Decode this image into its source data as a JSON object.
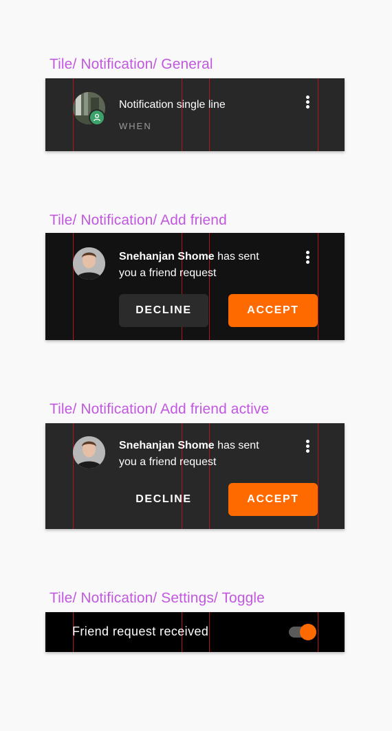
{
  "sections": {
    "general": {
      "title": "Tile/ Notification/ General",
      "line": "Notification single line",
      "when": "WHEN"
    },
    "add_friend": {
      "title": "Tile/ Notification/ Add friend",
      "name": "Snehanjan Shome",
      "message_part1": "has sent",
      "message_part2": "you a friend request",
      "decline": "DECLINE",
      "accept": "ACCEPT"
    },
    "add_friend_active": {
      "title": "Tile/ Notification/ Add friend active",
      "name": "Snehanjan Shome",
      "message_part1": "has sent",
      "message_part2": "you a friend request",
      "decline": "DECLINE",
      "accept": "ACCEPT"
    },
    "settings_toggle": {
      "title": "Tile/ Notification/ Settings/ Toggle",
      "label": "Friend request received",
      "toggle_on": true
    }
  },
  "colors": {
    "accent": "#ff6a00",
    "title_purple": "#c257e0",
    "tile_dark": "#282828",
    "tile_darker": "#121212",
    "guide_red": "#b3141e",
    "badge_green": "#3ca26a"
  }
}
